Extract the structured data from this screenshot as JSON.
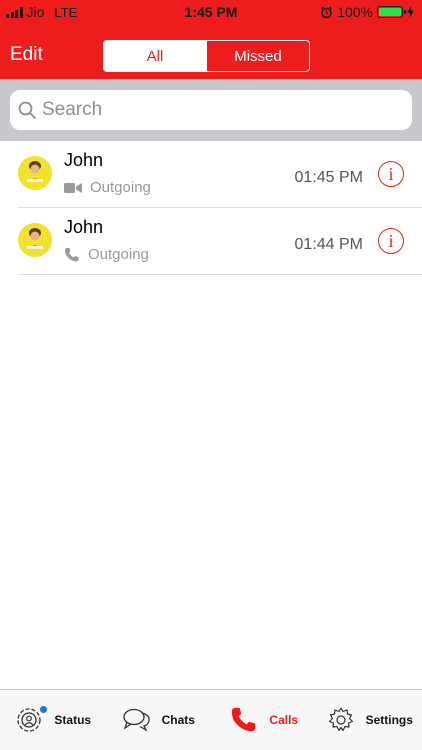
{
  "status_bar": {
    "carrier": "Jio",
    "network": "LTE",
    "time": "1:45 PM",
    "battery": "100%",
    "battery_level": 1.0
  },
  "nav": {
    "edit_label": "Edit",
    "segments": [
      "All",
      "Missed"
    ],
    "selected_segment": "All"
  },
  "search": {
    "placeholder": "Search"
  },
  "calls": [
    {
      "name": "John",
      "type": "Outgoing",
      "icon": "video-icon",
      "time": "01:45 PM"
    },
    {
      "name": "John",
      "type": "Outgoing",
      "icon": "phone-icon",
      "time": "01:44 PM"
    }
  ],
  "tabs": [
    {
      "label": "Status",
      "icon": "status-icon",
      "badge": true
    },
    {
      "label": "Chats",
      "icon": "chats-icon"
    },
    {
      "label": "Calls",
      "icon": "phone-icon",
      "active": true
    },
    {
      "label": "Settings",
      "icon": "gear-icon"
    }
  ],
  "colors": {
    "accent": "#ee1d1d",
    "secondary_text": "#9a9a9a",
    "badge": "#1a73e8"
  }
}
